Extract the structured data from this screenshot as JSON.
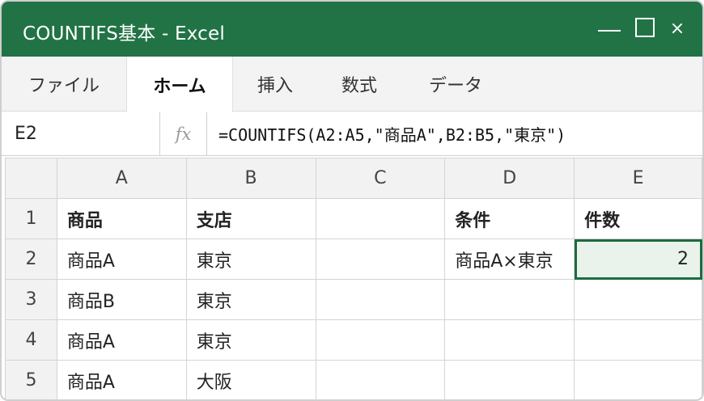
{
  "window": {
    "title": "COUNTIFS基本 - Excel"
  },
  "controls": {
    "close": "×"
  },
  "ribbon": {
    "tabs": [
      "ファイル",
      "ホーム",
      "挿入",
      "数式",
      "データ"
    ],
    "active": "ホーム"
  },
  "formula_bar": {
    "cell_ref": "E2",
    "fx": "fx",
    "formula": "=COUNTIFS(A2:A5,\"商品A\",B2:B5,\"東京\")"
  },
  "grid": {
    "columns": [
      "A",
      "B",
      "C",
      "D",
      "E"
    ],
    "rows": [
      {
        "num": "1",
        "cells": [
          "商品",
          "支店",
          "",
          "条件",
          "件数"
        ]
      },
      {
        "num": "2",
        "cells": [
          "商品A",
          "東京",
          "",
          "商品A×東京",
          "2"
        ]
      },
      {
        "num": "3",
        "cells": [
          "商品B",
          "東京",
          "",
          "",
          ""
        ]
      },
      {
        "num": "4",
        "cells": [
          "商品A",
          "東京",
          "",
          "",
          ""
        ]
      },
      {
        "num": "5",
        "cells": [
          "商品A",
          "大阪",
          "",
          "",
          ""
        ]
      }
    ],
    "selected_cell": "E2"
  },
  "colors": {
    "titlebar": "#217346",
    "selection_border": "#1e6b3e",
    "selection_fill": "#e9f3ec"
  }
}
